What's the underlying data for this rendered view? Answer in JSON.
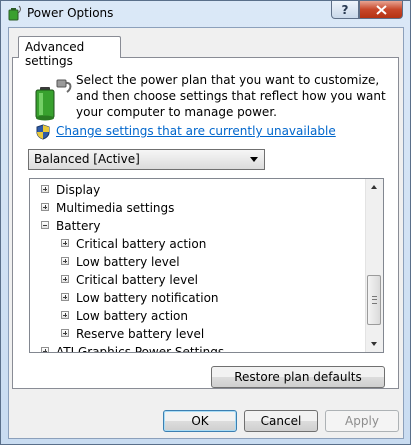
{
  "window": {
    "title": "Power Options",
    "help_label": "?",
    "close_label": "x"
  },
  "tabs": [
    {
      "label": "Advanced settings",
      "selected": true
    }
  ],
  "intro_text": "Select the power plan that you want to customize, and then choose settings that reflect how you want your computer to manage power.",
  "change_link": "Change settings that are currently unavailable",
  "plan_select": {
    "value": "Balanced [Active]"
  },
  "tree_items": [
    {
      "label": "Display",
      "expander": "plus"
    },
    {
      "label": "Multimedia settings",
      "expander": "plus"
    },
    {
      "label": "Battery",
      "expander": "minus"
    },
    {
      "label": "Critical battery action",
      "expander": "plus"
    },
    {
      "label": "Low battery level",
      "expander": "plus"
    },
    {
      "label": "Critical battery level",
      "expander": "plus"
    },
    {
      "label": "Low battery notification",
      "expander": "plus"
    },
    {
      "label": "Low battery action",
      "expander": "plus"
    },
    {
      "label": "Reserve battery level",
      "expander": "plus"
    },
    {
      "label": "ATI Graphics Power Settings",
      "expander": "plus"
    }
  ],
  "buttons": {
    "restore": "Restore plan defaults",
    "ok": "OK",
    "cancel": "Cancel",
    "apply": "Apply"
  },
  "colors": {
    "link": "#0066cc",
    "close_button": "#c7472a",
    "disabled_text": "#8d8d8d"
  },
  "icons": {
    "app": "power-options-icon",
    "battery": "battery-plug-icon",
    "shield": "uac-shield-icon"
  }
}
